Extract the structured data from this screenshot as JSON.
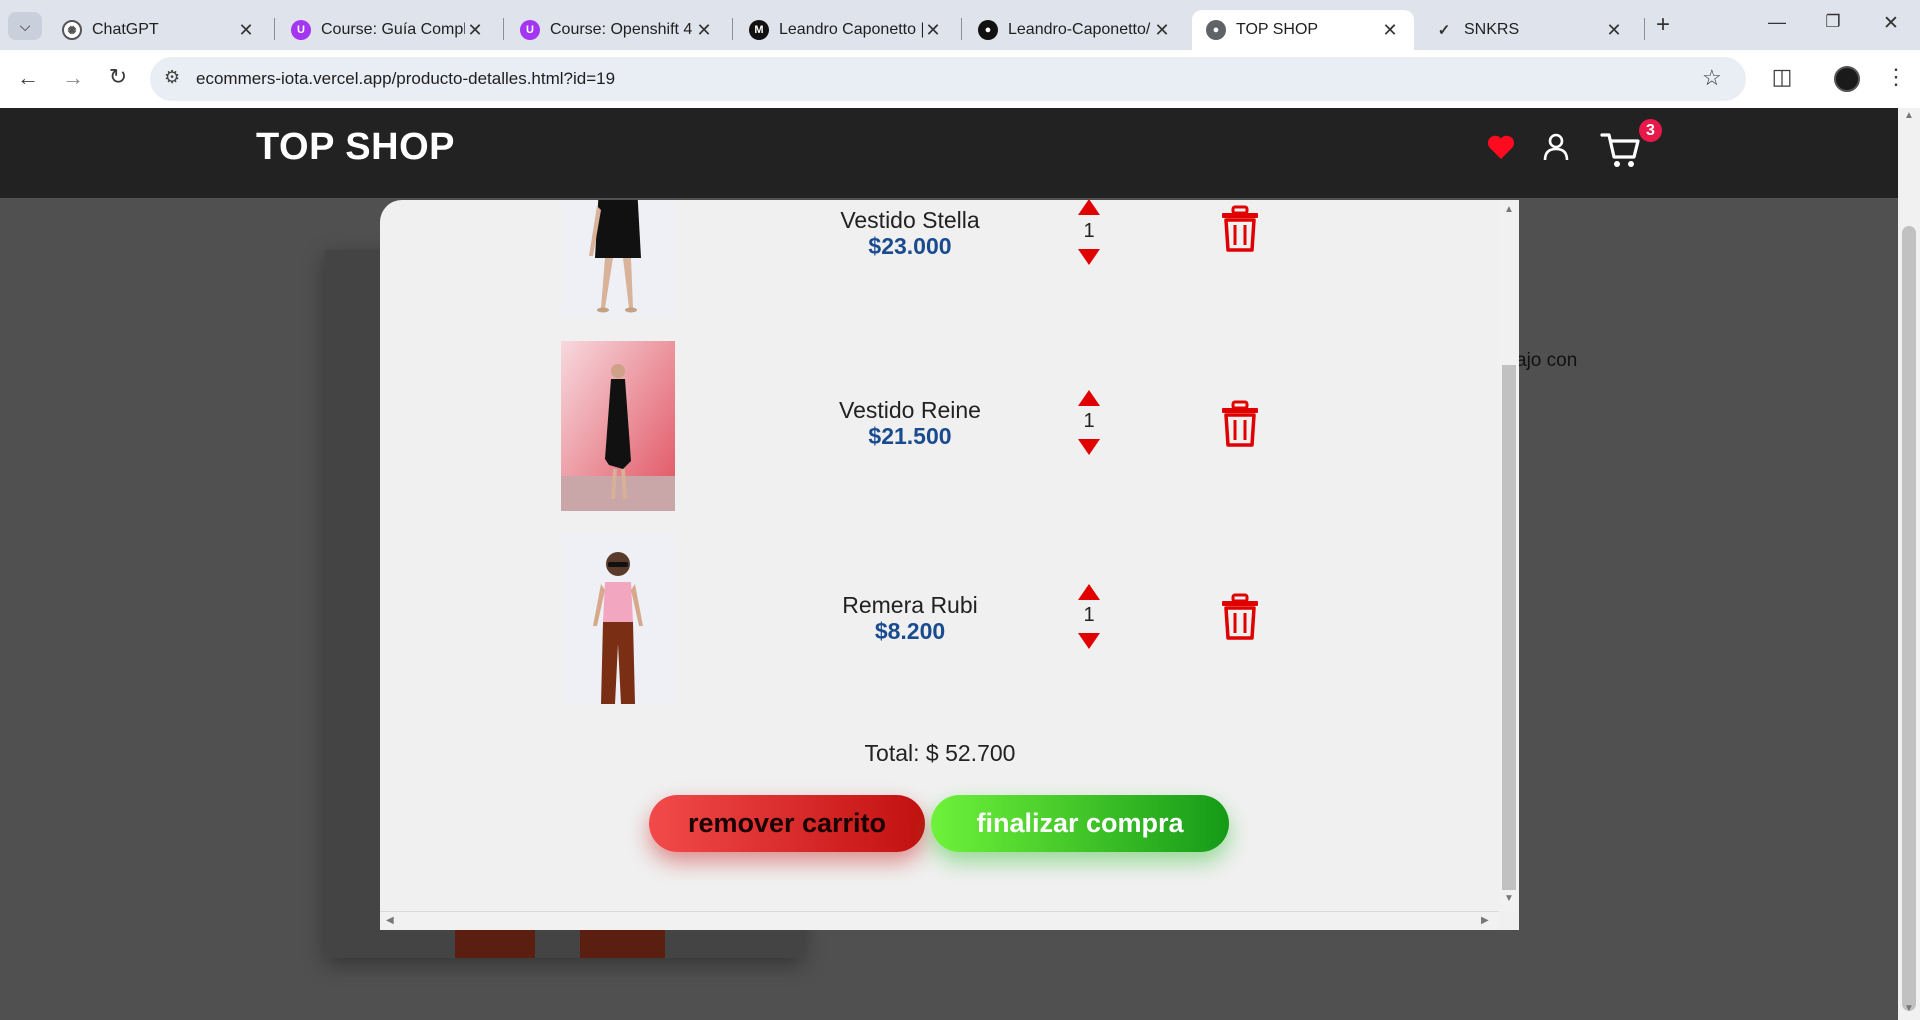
{
  "browser": {
    "tabs": [
      {
        "label": "ChatGPT",
        "icon": "chatgpt-icon",
        "active": false
      },
      {
        "label": "Course: Guía Comple",
        "icon": "udemy-icon",
        "active": false
      },
      {
        "label": "Course: Openshift 4 c",
        "icon": "udemy-icon",
        "active": false
      },
      {
        "label": "Leandro Caponetto |",
        "icon": "medium-icon",
        "active": false
      },
      {
        "label": "Leandro-Caponetto/",
        "icon": "github-icon",
        "active": false
      },
      {
        "label": "TOP SHOP",
        "icon": "globe-icon",
        "active": true
      },
      {
        "label": "SNKRS",
        "icon": "nike-icon",
        "active": false
      }
    ],
    "url": "ecommers-iota.vercel.app/producto-detalles.html?id=19"
  },
  "site": {
    "brand": "TOP SHOP",
    "cart_count": "3",
    "background_text": "ajo con"
  },
  "cart": {
    "items": [
      {
        "name": "Vestido Stella",
        "price": "$23.000",
        "qty": "1"
      },
      {
        "name": "Vestido Reine",
        "price": "$21.500",
        "qty": "1"
      },
      {
        "name": "Remera Rubi",
        "price": "$8.200",
        "qty": "1"
      }
    ],
    "total": "Total: $ 52.700",
    "remove_label": "remover carrito",
    "checkout_label": "finalizar compra"
  },
  "colors": {
    "header_bg": "#222222",
    "price": "#1a4b8f",
    "danger": "#e00000",
    "checkout_green": "#159a18",
    "badge": "#e8194a"
  }
}
